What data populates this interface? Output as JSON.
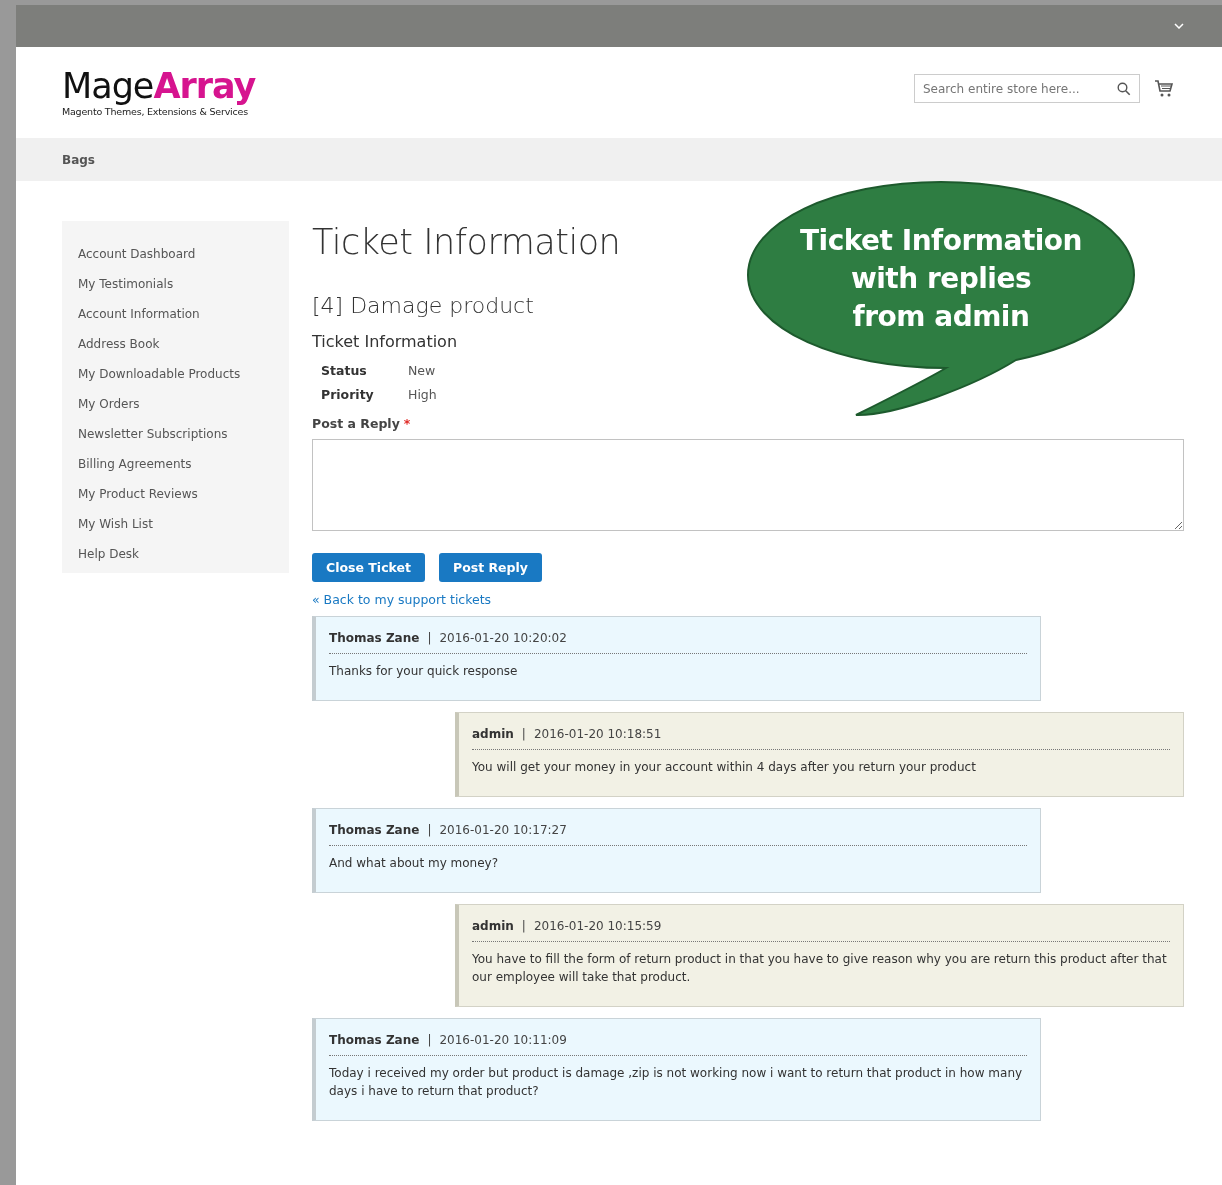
{
  "logo": {
    "part_1": "Mage",
    "part_2": "Array",
    "tagline": "Magento Themes, Extensions & Services"
  },
  "search": {
    "placeholder": "Search entire store here..."
  },
  "nav": {
    "items": [
      "Bags"
    ]
  },
  "sidebar": {
    "items": [
      {
        "label": "Account Dashboard"
      },
      {
        "label": "My Testimonials"
      },
      {
        "label": "Account Information"
      },
      {
        "label": "Address Book"
      },
      {
        "label": "My Downloadable Products"
      },
      {
        "label": "My Orders"
      },
      {
        "label": "Newsletter Subscriptions"
      },
      {
        "label": "Billing Agreements"
      },
      {
        "label": "My Product Reviews"
      },
      {
        "label": "My Wish List"
      },
      {
        "label": "Help Desk"
      }
    ]
  },
  "page_title": "Ticket Information",
  "ticket_subject": "[4] Damage product",
  "section_title": "Ticket Information",
  "fields": [
    {
      "label": "Status",
      "value": "New"
    },
    {
      "label": "Priority",
      "value": "High"
    }
  ],
  "reply": {
    "label": "Post a Reply",
    "required_mark": "*"
  },
  "buttons": [
    "Close Ticket",
    "Post Reply"
  ],
  "back_link": "« Back to my support tickets",
  "callout": {
    "lines": [
      "Ticket Information",
      "with replies",
      "from admin"
    ]
  },
  "messages": [
    {
      "kind": "customer",
      "author": "Thomas Zane",
      "separator": "|",
      "time": "2016-01-20 10:20:02",
      "text": "Thanks for your quick response"
    },
    {
      "kind": "admin",
      "author": "admin",
      "separator": "|",
      "time": "2016-01-20 10:18:51",
      "text": "You will get your money in your account within 4 days after you return your product"
    },
    {
      "kind": "customer",
      "author": "Thomas Zane",
      "separator": "|",
      "time": "2016-01-20 10:17:27",
      "text": "And what about my money?"
    },
    {
      "kind": "admin",
      "author": "admin",
      "separator": "|",
      "time": "2016-01-20 10:15:59",
      "text": "You have to fill the form of return product in that you have to give reason why you are return this product after that our employee will take that product."
    },
    {
      "kind": "customer",
      "author": "Thomas Zane",
      "separator": "|",
      "time": "2016-01-20 10:11:09",
      "text": "Today i received my order but product is damage ,zip is not working now i want to return that product in how many days i have to return that product?"
    }
  ]
}
